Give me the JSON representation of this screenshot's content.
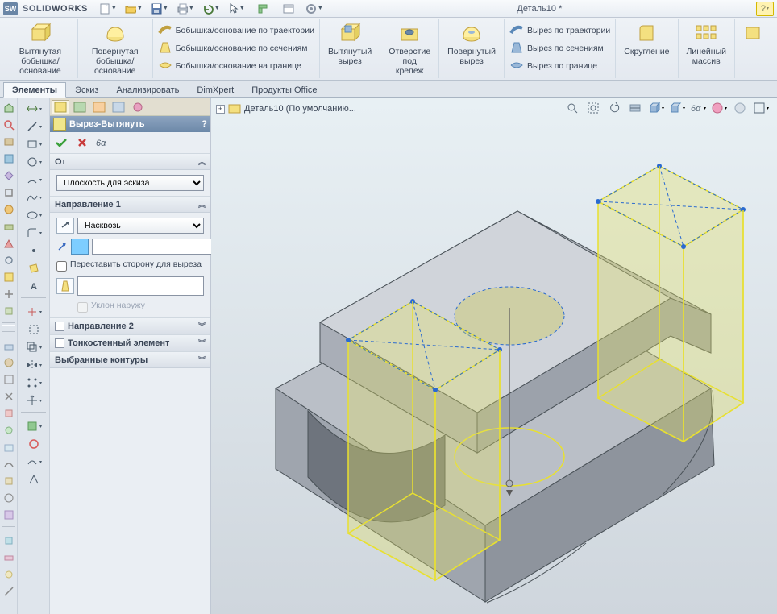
{
  "app": {
    "name_thin": "SOLID",
    "name_bold": "WORKS"
  },
  "title": "Деталь10 *",
  "ribbon": {
    "extrude_boss": "Вытянутая\nбобышка/основание",
    "revolve_boss": "Повернутая\nбобышка/основание",
    "swept_boss": "Бобышка/основание по траектории",
    "lofted_boss": "Бобышка/основание по сечениям",
    "boundary_boss": "Бобышка/основание на границе",
    "extrude_cut": "Вытянутый\nвырез",
    "hole": "Отверстие\nпод\nкрепеж",
    "revolve_cut": "Повернутый\nвырез",
    "swept_cut": "Вырез по траектории",
    "lofted_cut": "Вырез по сечениям",
    "boundary_cut": "Вырез по границе",
    "fillet": "Скругление",
    "linear_pattern": "Линейный\nмассив"
  },
  "tabs": {
    "elements": "Элементы",
    "sketch": "Эскиз",
    "analyze": "Анализировать",
    "dimxpert": "DimXpert",
    "office": "Продукты Office"
  },
  "tree": {
    "root": "Деталь10  (По умолчанию..."
  },
  "prop": {
    "title": "Вырез-Вытянуть",
    "from_header": "От",
    "from_value": "Плоскость для эскиза",
    "dir1_header": "Направление 1",
    "dir1_end": "Насквозь",
    "flip_label": "Переставить сторону для выреза",
    "draft_label": "Уклон наружу",
    "dir2_header": "Направление 2",
    "thin_header": "Тонкостенный элемент",
    "contours_header": "Выбранные контуры"
  }
}
